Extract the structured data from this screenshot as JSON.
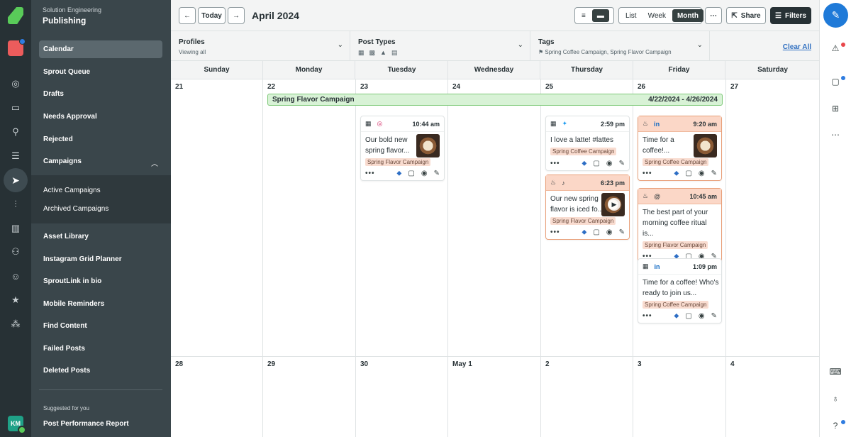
{
  "nav": {
    "org": "Solution Engineering",
    "section": "Publishing",
    "items": [
      "Calendar",
      "Sprout Queue",
      "Drafts",
      "Needs Approval",
      "Rejected",
      "Campaigns"
    ],
    "campaign_sub": [
      "Active Campaigns",
      "Archived Campaigns"
    ],
    "items2": [
      "Asset Library",
      "Instagram Grid Planner",
      "SproutLink in bio",
      "Mobile Reminders",
      "Find Content",
      "Failed Posts",
      "Deleted Posts"
    ],
    "suggested_title": "Suggested for you",
    "suggested_item": "Post Performance Report",
    "avatar_initials": "KM"
  },
  "toolbar": {
    "today": "Today",
    "month_title": "April 2024",
    "view_list": "List",
    "view_week": "Week",
    "view_month": "Month",
    "share": "Share",
    "filters": "Filters"
  },
  "filters": {
    "profiles_title": "Profiles",
    "profiles_sub": "Viewing all",
    "post_types_title": "Post Types",
    "tags_title": "Tags",
    "tags_sub": "Spring Coffee Campaign, Spring Flavor Campaign",
    "clear_all": "Clear All"
  },
  "weekdays": [
    "Sunday",
    "Monday",
    "Tuesday",
    "Wednesday",
    "Thursday",
    "Friday",
    "Saturday"
  ],
  "week1_dates": [
    "21",
    "22",
    "23",
    "24",
    "25",
    "26",
    "27"
  ],
  "week2_dates": [
    "28",
    "29",
    "30",
    "May 1",
    "2",
    "3",
    "4"
  ],
  "campaign": {
    "name": "Spring Flavor Campaign",
    "range": "4/22/2024 - 4/26/2024"
  },
  "posts": {
    "tue1": {
      "time": "10:44 am",
      "text": "Our bold new spring flavor...",
      "tag": "Spring Flavor Campaign"
    },
    "thu1": {
      "time": "2:59 pm",
      "text": "I love a latte! #lattes",
      "tag": "Spring Coffee Campaign"
    },
    "thu2": {
      "time": "6:23 pm",
      "text": "Our new spring flavor is iced fo...",
      "tag": "Spring Flavor Campaign"
    },
    "fri1": {
      "time": "9:20 am",
      "text": "Time for a coffee!...",
      "tag": "Spring Coffee Campaign"
    },
    "fri2": {
      "time": "10:45 am",
      "text": "The best part of your morning coffee ritual is...",
      "tag": "Spring Flavor Campaign"
    },
    "fri3": {
      "time": "1:09 pm",
      "text": "Time for a coffee! Who's ready to join us...",
      "tag": "Spring Coffee Campaign"
    }
  },
  "colors": {
    "rail_bg": "#273135",
    "nav_bg": "#3a464b",
    "accent_blue": "#1f7ad8",
    "campaign_green": "#d8f2d6",
    "draft_peach": "#fbd7c7"
  }
}
